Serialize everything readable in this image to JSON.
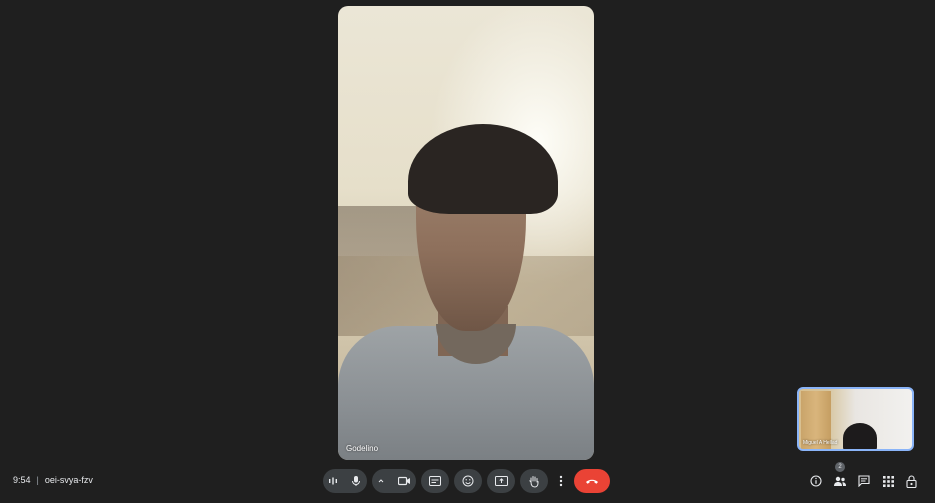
{
  "meeting": {
    "time": "9:54",
    "separator": "|",
    "code": "oei-svya-fzv"
  },
  "participants": {
    "main": {
      "name": "Godelino"
    },
    "self": {
      "name": "Miguel A Hellad"
    },
    "count": "2"
  },
  "controls": [
    {
      "name": "audio-level",
      "icon": "audio-level-icon"
    },
    {
      "name": "microphone",
      "icon": "mic-icon"
    },
    {
      "name": "camera-options",
      "icon": "chevron-up-icon"
    },
    {
      "name": "camera",
      "icon": "video-camera-icon"
    },
    {
      "name": "captions",
      "icon": "captions-icon"
    },
    {
      "name": "emoji",
      "icon": "emoji-icon"
    },
    {
      "name": "present",
      "icon": "present-screen-icon"
    },
    {
      "name": "raise-hand",
      "icon": "raise-hand-icon"
    },
    {
      "name": "more-options",
      "icon": "more-vert-icon"
    },
    {
      "name": "leave-call",
      "icon": "end-call-icon"
    }
  ],
  "right_controls": [
    {
      "name": "meeting-details",
      "icon": "info-icon"
    },
    {
      "name": "people",
      "icon": "people-icon"
    },
    {
      "name": "chat",
      "icon": "chat-icon"
    },
    {
      "name": "activities",
      "icon": "apps-icon"
    },
    {
      "name": "host-controls",
      "icon": "lock-person-icon"
    }
  ],
  "colors": {
    "background": "#1f1f1f",
    "button": "#3c4043",
    "end_call": "#ea4335",
    "self_border": "#8ab4f8"
  }
}
